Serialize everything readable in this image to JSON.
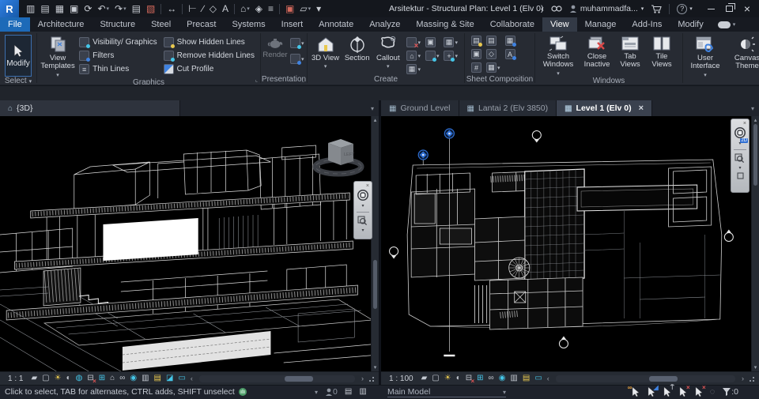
{
  "titlebar": {
    "title": "Arsitektur - Structural Plan: Level 1 (Elv 0)",
    "user": "muhammadfa..."
  },
  "ribbon": {
    "tabs": [
      {
        "label": "File"
      },
      {
        "label": "Architecture"
      },
      {
        "label": "Structure"
      },
      {
        "label": "Steel"
      },
      {
        "label": "Precast"
      },
      {
        "label": "Systems"
      },
      {
        "label": "Insert"
      },
      {
        "label": "Annotate"
      },
      {
        "label": "Analyze"
      },
      {
        "label": "Massing & Site"
      },
      {
        "label": "Collaborate"
      },
      {
        "label": "View"
      },
      {
        "label": "Manage"
      },
      {
        "label": "Add-Ins"
      },
      {
        "label": "Modify"
      }
    ],
    "select_panel": {
      "modify": "Modify",
      "label": "Select"
    },
    "graphics_panel": {
      "view_templates": "View Templates",
      "visibility": "Visibility/ Graphics",
      "filters": "Filters",
      "thin_lines": "Thin Lines",
      "show_hidden": "Show Hidden Lines",
      "remove_hidden": "Remove Hidden Lines",
      "cut_profile": "Cut Profile",
      "label": "Graphics"
    },
    "presentation_panel": {
      "render": "Render",
      "label": "Presentation"
    },
    "create_panel": {
      "view3d": "3D View",
      "section": "Section",
      "callout": "Callout",
      "label": "Create"
    },
    "sheet_panel": {
      "label": "Sheet Composition"
    },
    "windows_panel": {
      "switch": "Switch Windows",
      "close_inactive": "Close Inactive",
      "tab_views": "Tab Views",
      "tile_views": "Tile Views",
      "user_interface": "User Interface",
      "canvas_theme": "Canvas Theme",
      "label": "Windows"
    }
  },
  "left_viewport": {
    "tab": "{3D}",
    "scale": "1 : 1"
  },
  "right_viewport": {
    "tabs": [
      {
        "label": "Ground Level"
      },
      {
        "label": "Lantai 2 (Elv 3850)"
      },
      {
        "label": "Level 1 (Elv 0)"
      }
    ],
    "scale": "1 : 100"
  },
  "statusbar": {
    "hint": "Click to select, TAB for alternates, CTRL adds, SHIFT unselect",
    "design_option": "Main Model",
    "active_users": "0",
    "filter_count": ":0"
  },
  "colors": {
    "accent_blue": "#1d6ab8",
    "teal": "#45c6e8",
    "marker_blue": "#2f6fd4",
    "selection_yellow": "#e8c84f"
  },
  "glyphs": {
    "caret": "▾",
    "caret_up": "▴",
    "left": "‹",
    "right": "›",
    "interop": "▥",
    "new": "▤",
    "open": "▦",
    "save": "▣",
    "sync": "⟳",
    "undo": "↶",
    "redo": "↷",
    "print": "▤",
    "export": "▧",
    "measure": "↔",
    "dimension": "⊢",
    "line": "∕",
    "tag": "◇",
    "text": "A",
    "home": "⌂",
    "section": "◈",
    "thin": "≡",
    "closewin": "▣",
    "switch": "▱",
    "detail": "▰",
    "style": "▢",
    "sun": "☀",
    "shadow": "◐",
    "render_sm": "◍",
    "crop": "⊟",
    "crop_vis": "⊞",
    "lock": "⌂",
    "glasses": "∞",
    "bulb": "◉",
    "workshare": "▥",
    "tempview": "▤",
    "isolate": "◪",
    "selbox": "▭",
    "min": "–",
    "close": "×",
    "help": "?",
    "spinner": "◌",
    "x_small": "×",
    "plus": "+",
    "grid": "#",
    "legend": "▦",
    "plan": "⌂",
    "sheetpg": "▤",
    "dup": "▣",
    "scope": "✛"
  }
}
